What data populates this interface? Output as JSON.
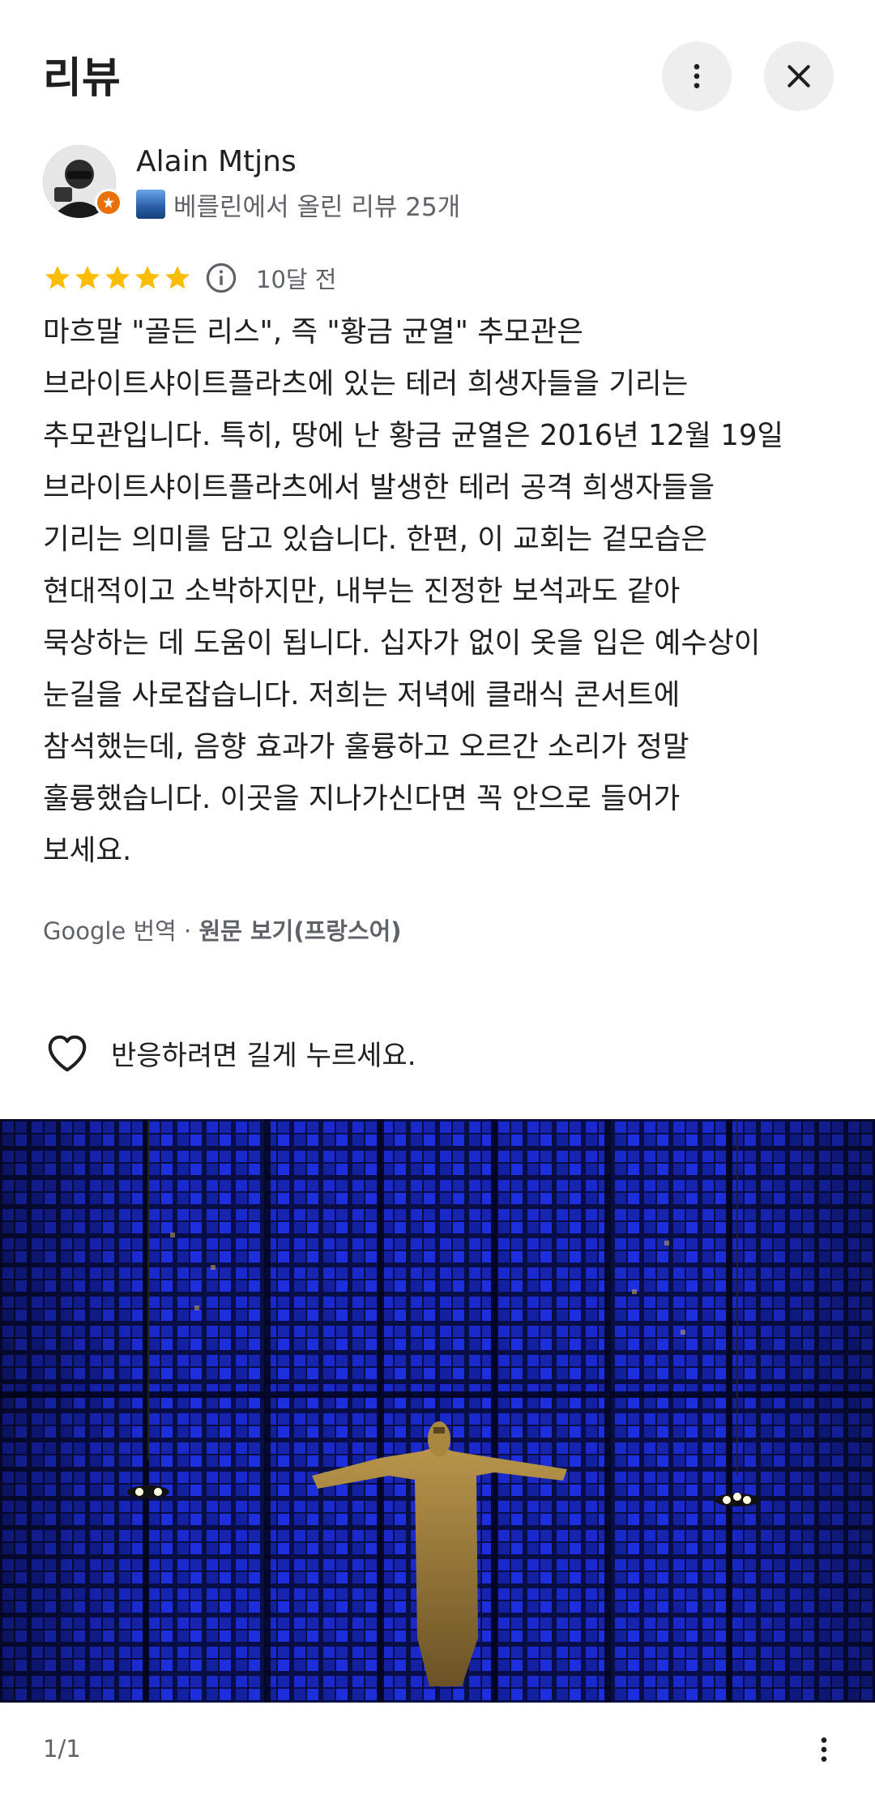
{
  "header": {
    "title": "리뷰",
    "more_icon": "more-vert-icon",
    "close_icon": "close-icon"
  },
  "author": {
    "name": "Alain Mtjns",
    "meta": "베를린에서 올린 리뷰 25개",
    "badge_icon": "local-guide-badge-icon",
    "badge_color": "#e8710a"
  },
  "rating": {
    "stars": 5,
    "star_color": "#fbbc04",
    "date": "10달 전"
  },
  "review": {
    "text": "마흐말 \"골든 리스\", 즉 \"황금 균열\" 추모관은\n브라이트샤이트플라츠에 있는 테러 희생자들을 기리는\n추모관입니다. 특히, 땅에 난 황금 균열은 2016년 12월 19일\n브라이트샤이트플라츠에서 발생한 테러 공격 희생자들을\n기리는 의미를 담고 있습니다. 한편, 이 교회는 겉모습은\n현대적이고 소박하지만, 내부는 진정한 보석과도 같아\n묵상하는 데 도움이 됩니다. 십자가 없이 옷을 입은 예수상이\n눈길을 사로잡습니다. 저희는 저녁에 클래식 콘서트에\n참석했는데, 음향 효과가 훌륭하고 오르간 소리가 정말\n훌륭했습니다. 이곳을 지나가신다면 꼭 안으로 들어가\n보세요."
  },
  "translation": {
    "prefix": "Google 번역 · ",
    "link": "원문 보기(프랑스어)"
  },
  "reaction": {
    "icon": "heart-icon",
    "text": "반응하려면 길게 누르세요."
  },
  "photo": {
    "counter": "1/1"
  }
}
